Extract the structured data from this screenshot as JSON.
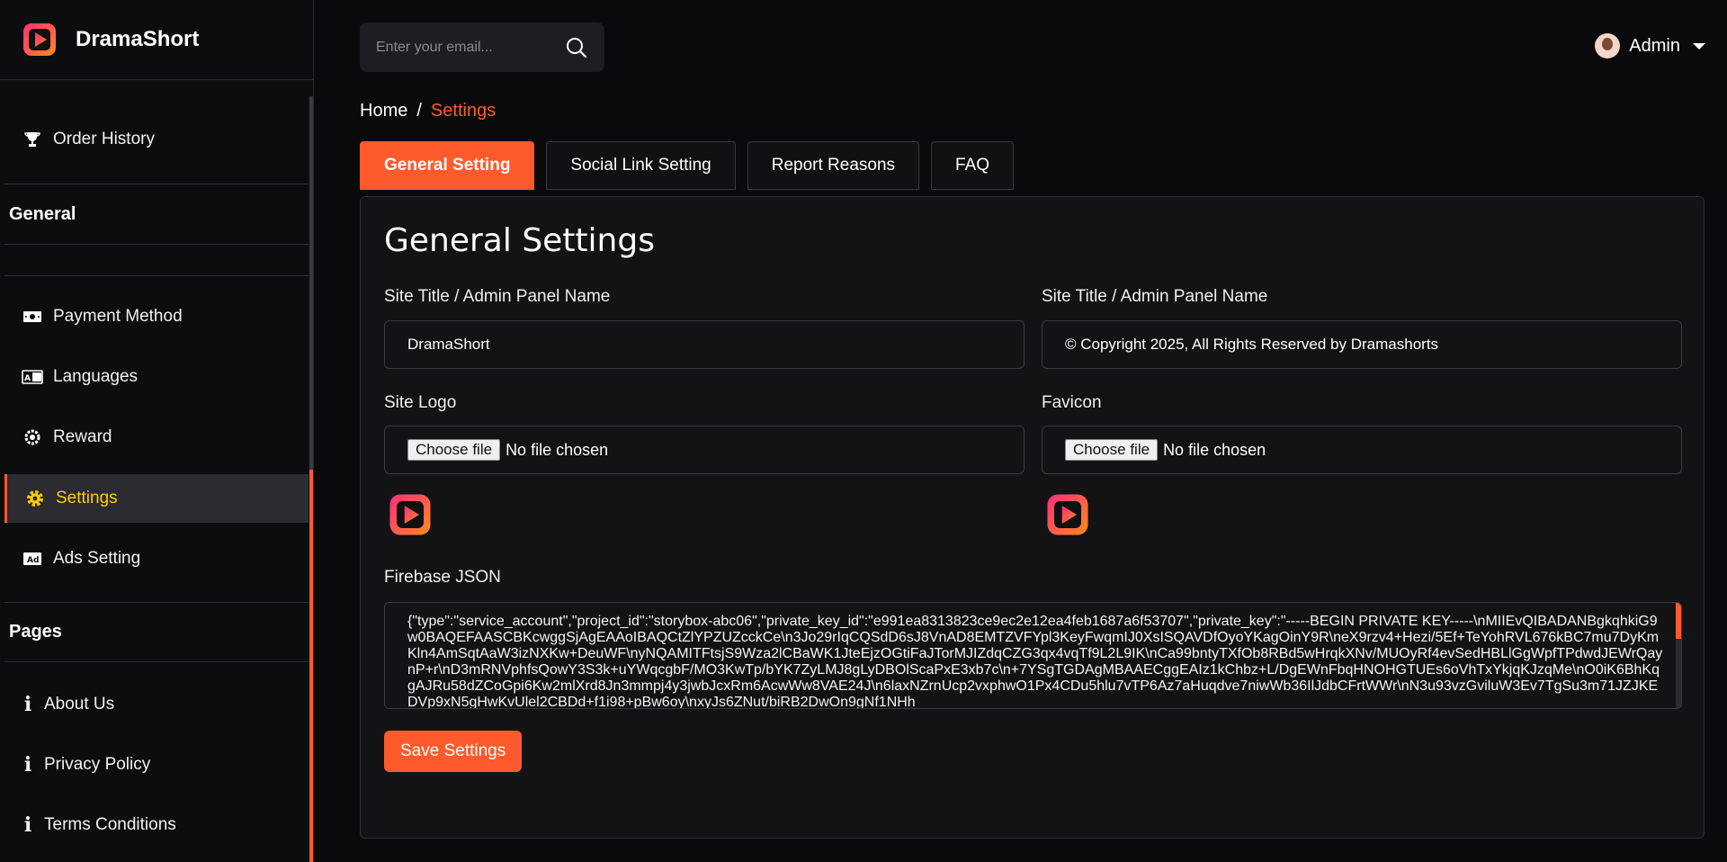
{
  "brand": {
    "name": "DramaShort"
  },
  "colors": {
    "accent": "#ff5a2c",
    "active_text": "#ffcc00",
    "background": "#0a0a0c",
    "panel": "#131316"
  },
  "sidebar": {
    "items_top": [
      {
        "label": "Order History",
        "icon": "trophy-icon"
      }
    ],
    "section_general": "General",
    "items_general": [
      {
        "label": "Payment Method",
        "icon": "cash-icon"
      },
      {
        "label": "Languages",
        "icon": "language-icon"
      },
      {
        "label": "Reward",
        "icon": "reward-icon"
      },
      {
        "label": "Settings",
        "icon": "gear-icon",
        "active": true
      },
      {
        "label": "Ads Setting",
        "icon": "ad-icon"
      }
    ],
    "section_pages": "Pages",
    "items_pages": [
      {
        "label": "About Us",
        "icon": "info-icon"
      },
      {
        "label": "Privacy Policy",
        "icon": "info-icon"
      },
      {
        "label": "Terms Conditions",
        "icon": "info-icon"
      }
    ]
  },
  "topbar": {
    "search_placeholder": "Enter your email...",
    "user_name": "Admin"
  },
  "breadcrumb": {
    "home": "Home",
    "separator": "/",
    "current": "Settings"
  },
  "tabs": [
    {
      "label": "General Setting",
      "active": true
    },
    {
      "label": "Social Link Setting"
    },
    {
      "label": "Report Reasons"
    },
    {
      "label": "FAQ"
    }
  ],
  "form": {
    "title": "General Settings",
    "site_title_label": "Site Title / Admin Panel Name",
    "site_title_value": "DramaShort",
    "copyright_label": "Site Title / Admin Panel Name",
    "copyright_value": "© Copyright 2025, All Rights Reserved by Dramashorts",
    "site_logo_label": "Site Logo",
    "favicon_label": "Favicon",
    "file_button": "Choose file",
    "file_status": "No file chosen",
    "firebase_label": "Firebase JSON",
    "firebase_value": "{\"type\":\"service_account\",\"project_id\":\"storybox-abc06\",\"private_key_id\":\"e991ea8313823ce9ec2e12ea4feb1687a6f53707\",\"private_key\":\"-----BEGIN PRIVATE KEY-----\\nMIIEvQIBADANBgkqhkiG9w0BAQEFAASCBKcwggSjAgEAAoIBAQCtZlYPZUZcckCe\\n3Jo29rIqCQSdD6sJ8VnAD8EMTZVFYpl3KeyFwqmIJ0XsISQAVDfOyoYKagOinY9R\\neX9rzv4+Hezi/5Ef+TeYohRVL676kBC7mu7DyKmKln4AmSqtAaW3izNXKw+DeuWF\\nyNQAMITFtsjS9Wza2lCBaWK1JteEjzOGtiFaJTorMJIZdqCZG3qx4vqTf9L2L9IK\\nCa99bntyTXfOb8RBd5wHrqkXNv/MUOyRf4evSedHBLlGgWpfTPdwdJEWrQaynP+r\\nD3mRNVphfsQowY3S3k+uYWqcgbF/MO3KwTp/bYK7ZyLMJ8gLyDBOlScaPxE3xb7c\\n+7YSgTGDAgMBAAECggEAIz1kChbz+L/DgEWnFbqHNOHGTUEs6oVhTxYkjqKJzqMe\\nO0iK6BhKqgAJRu58dZCoGpi6Kw2mlXrd8Jn3mmpj4y3jwbJcxRm6AcwWw8VAE24J\\n6laxNZrnUcp2vxphwO1Px4CDu5hlu7vTP6Az7aHuqdve7niwWb36IlJdbCFrtWWr\\nN3u93vzGviluW3Ev7TgSu3m71JZJKEDVp9xN5gHwKvUlel2CBDd+f1i98+pBw6oy\\nxyJs6ZNut/biRB2DwOn9gNf1NHh",
    "save_button": "Save Settings"
  }
}
